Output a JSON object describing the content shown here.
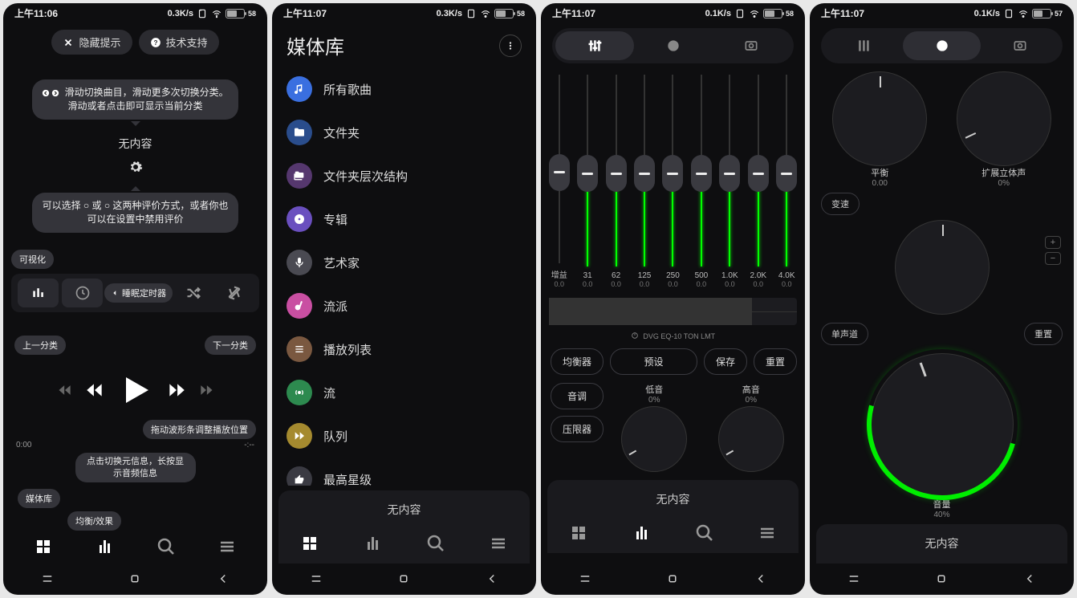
{
  "screens": [
    {
      "time": "上午11:06",
      "speed": "0.3K/s",
      "battery": "58"
    },
    {
      "time": "上午11:07",
      "speed": "0.3K/s",
      "battery": "58"
    },
    {
      "time": "上午11:07",
      "speed": "0.1K/s",
      "battery": "58"
    },
    {
      "time": "上午11:07",
      "speed": "0.1K/s",
      "battery": "57"
    }
  ],
  "screen1": {
    "hide_tip": "隐藏提示",
    "support": "技术支持",
    "tip_swipe": "滑动切换曲目，滑动更多次切换分类。 滑动或者点击即可显示当前分类",
    "no_content": "无内容",
    "tip_rating": "可以选择 ○ 或 ○ 这两种评价方式，或者你也可以在设置中禁用评价",
    "visualize": "可视化",
    "sleep_timer": "睡眠定时器",
    "prev_cat": "上一分类",
    "next_cat": "下一分类",
    "drag_wave": "拖动波形条调整播放位置",
    "time_start": "0:00",
    "time_end": "-:--",
    "toggle_info": "点击切换元信息，长按显示音频信息",
    "library": "媒体库",
    "eq_fx": "均衡/效果"
  },
  "library": {
    "title": "媒体库",
    "no_content": "无内容",
    "items": [
      {
        "label": "所有歌曲",
        "icon": "note",
        "color": "#3a6fe0"
      },
      {
        "label": "文件夹",
        "icon": "folder",
        "color": "#2a4d8c"
      },
      {
        "label": "文件夹层次结构",
        "icon": "folders",
        "color": "#55376e"
      },
      {
        "label": "专辑",
        "icon": "disc",
        "color": "#6a4fbf"
      },
      {
        "label": "艺术家",
        "icon": "mic",
        "color": "#4a4a52"
      },
      {
        "label": "流派",
        "icon": "guitar",
        "color": "#c94fa2"
      },
      {
        "label": "播放列表",
        "icon": "list",
        "color": "#7a5840"
      },
      {
        "label": "流",
        "icon": "cast",
        "color": "#2d8a4f"
      },
      {
        "label": "队列",
        "icon": "queue",
        "color": "#a58a2f"
      },
      {
        "label": "最高星级",
        "icon": "thumb",
        "color": "#3a3a42"
      }
    ]
  },
  "eq": {
    "no_content": "无内容",
    "gain_label": "增益",
    "bands": [
      {
        "label": "31",
        "val": "0.0"
      },
      {
        "label": "62",
        "val": "0.0"
      },
      {
        "label": "125",
        "val": "0.0"
      },
      {
        "label": "250",
        "val": "0.0"
      },
      {
        "label": "500",
        "val": "0.0"
      },
      {
        "label": "1.0K",
        "val": "0.0"
      },
      {
        "label": "2.0K",
        "val": "0.0"
      },
      {
        "label": "4.0K",
        "val": "0.0"
      }
    ],
    "gain_val": "0.0",
    "chain": "DVG EQ-10 TON LMT",
    "equalizer": "均衡器",
    "preset": "预设",
    "save": "保存",
    "reset": "重置",
    "tone": "音调",
    "limiter": "压限器",
    "bass": "低音",
    "bass_val": "0%",
    "treble": "高音",
    "treble_val": "0%"
  },
  "knobs": {
    "no_content": "无内容",
    "balance": "平衡",
    "balance_val": "0.00",
    "stereo": "扩展立体声",
    "stereo_val": "0%",
    "tempo": "变速",
    "mono": "单声道",
    "reset": "重置",
    "volume": "音量",
    "volume_val": "40%"
  }
}
